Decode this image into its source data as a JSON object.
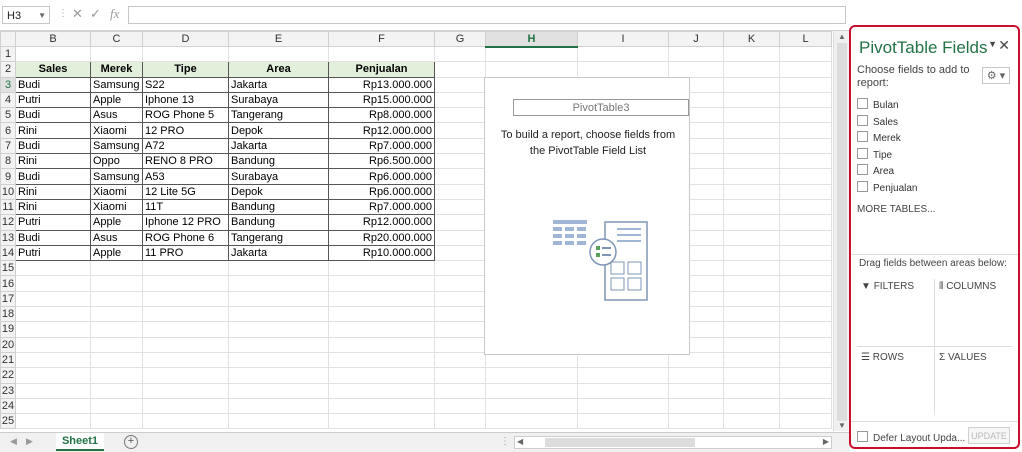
{
  "formula_bar": {
    "name_box": "H3",
    "cancel_icon": "✕",
    "enter_icon": "✓",
    "fx_label": "fx",
    "formula": ""
  },
  "columns": [
    "B",
    "C",
    "D",
    "E",
    "F",
    "G",
    "H",
    "I",
    "J",
    "K",
    "L"
  ],
  "rows": [
    "1",
    "2",
    "3",
    "4",
    "5",
    "6",
    "7",
    "8",
    "9",
    "10",
    "11",
    "12",
    "13",
    "14",
    "15",
    "16",
    "17",
    "18",
    "19",
    "20",
    "21",
    "22",
    "23",
    "24",
    "25"
  ],
  "table": {
    "headers": [
      "Sales",
      "Merek",
      "Tipe",
      "Area",
      "Penjualan"
    ],
    "data": [
      [
        "Budi",
        "Samsung",
        "S22",
        "Jakarta",
        "Rp13.000.000"
      ],
      [
        "Putri",
        "Apple",
        "Iphone 13",
        "Surabaya",
        "Rp15.000.000"
      ],
      [
        "Budi",
        "Asus",
        "ROG Phone 5",
        "Tangerang",
        "Rp8.000.000"
      ],
      [
        "Rini",
        "Xiaomi",
        "12 PRO",
        "Depok",
        "Rp12.000.000"
      ],
      [
        "Budi",
        "Samsung",
        "A72",
        "Jakarta",
        "Rp7.000.000"
      ],
      [
        "Rini",
        "Oppo",
        "RENO 8 PRO",
        "Bandung",
        "Rp6.500.000"
      ],
      [
        "Budi",
        "Samsung",
        "A53",
        "Surabaya",
        "Rp6.000.000"
      ],
      [
        "Rini",
        "Xiaomi",
        "12 Lite 5G",
        "Depok",
        "Rp6.000.000"
      ],
      [
        "Rini",
        "Xiaomi",
        "11T",
        "Bandung",
        "Rp7.000.000"
      ],
      [
        "Putri",
        "Apple",
        "Iphone 12 PRO",
        "Bandung",
        "Rp12.000.000"
      ],
      [
        "Budi",
        "Asus",
        "ROG Phone 6",
        "Tangerang",
        "Rp20.000.000"
      ],
      [
        "Putri",
        "Apple",
        "11 PRO",
        "Jakarta",
        "Rp10.000.000"
      ]
    ]
  },
  "pivot_placeholder": {
    "name": "PivotTable3",
    "message": "To build a report, choose fields from the PivotTable Field List"
  },
  "sheet_tab": "Sheet1",
  "panel": {
    "title": "PivotTable Fields",
    "choose_label": "Choose fields to add to report:",
    "fields": [
      "Bulan",
      "Sales",
      "Merek",
      "Tipe",
      "Area",
      "Penjualan"
    ],
    "more_tables": "MORE TABLES...",
    "drag_label": "Drag fields between areas below:",
    "filters": "FILTERS",
    "columns": "COLUMNS",
    "rows": "ROWS",
    "values": "VALUES",
    "defer_label": "Defer Layout Upda...",
    "update_button": "UPDATE"
  },
  "colors": {
    "accent": "#217346",
    "header_fill": "#e2efda",
    "panel_border": "#c8102e"
  }
}
